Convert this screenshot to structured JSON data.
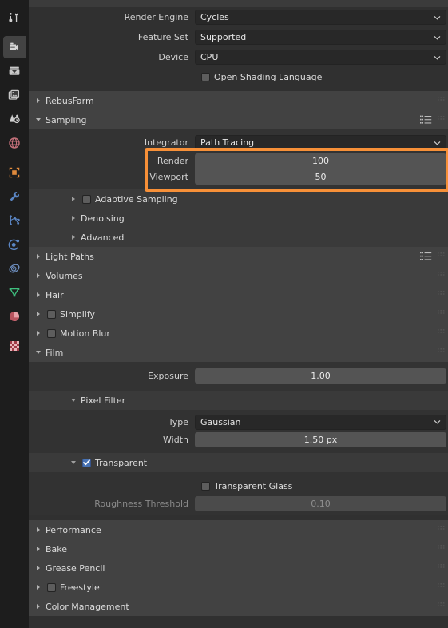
{
  "app": {
    "name": "Blender",
    "editor": "Properties Editor",
    "active_tab": "render-properties",
    "accent_orange": "#f79038",
    "accent_blue": "#4772b3",
    "bg": "#303030",
    "panel_header_bg": "#424242",
    "field_bg": "#545454",
    "dropdown_bg": "#282828"
  },
  "tabs": [
    {
      "name": "tool",
      "icon": "tool-icon",
      "active": false
    },
    {
      "name": "render-properties",
      "icon": "camera-back-icon",
      "active": true
    },
    {
      "name": "output-properties",
      "icon": "printer-icon",
      "active": false
    },
    {
      "name": "view-layer-properties",
      "icon": "images-icon",
      "active": false
    },
    {
      "name": "scene-properties",
      "icon": "cone-droplet-icon",
      "active": false
    },
    {
      "name": "world-properties",
      "icon": "globe-icon",
      "active": false
    },
    {
      "name": "object-properties",
      "icon": "orange-square-icon",
      "active": false
    },
    {
      "name": "modifier-properties",
      "icon": "wrench-icon",
      "active": false
    },
    {
      "name": "particle-properties",
      "icon": "particles-icon",
      "active": false
    },
    {
      "name": "physics-properties",
      "icon": "physics-orbit-icon",
      "active": false
    },
    {
      "name": "constraint-properties",
      "icon": "constraint-icon",
      "active": false
    },
    {
      "name": "object-data-properties",
      "icon": "green-triangle-mesh-icon",
      "active": false
    },
    {
      "name": "material-properties",
      "icon": "material-sphere-icon",
      "active": false
    },
    {
      "name": "texture-properties",
      "icon": "checker-texture-icon",
      "active": false
    }
  ],
  "render": {
    "engine": {
      "label": "Render Engine",
      "value": "Cycles"
    },
    "feature_set": {
      "label": "Feature Set",
      "value": "Supported"
    },
    "device": {
      "label": "Device",
      "value": "CPU"
    },
    "osl": {
      "label": "Open Shading Language",
      "checked": false
    }
  },
  "panels": {
    "rebusfarm": {
      "label": "RebusFarm",
      "open": false,
      "checkbox": null
    },
    "sampling": {
      "label": "Sampling",
      "open": true,
      "checkbox": null,
      "has_presets": true
    },
    "light_paths": {
      "label": "Light Paths",
      "open": false,
      "checkbox": null,
      "has_presets": true
    },
    "volumes": {
      "label": "Volumes",
      "open": false,
      "checkbox": null
    },
    "hair": {
      "label": "Hair",
      "open": false,
      "checkbox": null
    },
    "simplify": {
      "label": "Simplify",
      "open": false,
      "checkbox": false
    },
    "motion_blur": {
      "label": "Motion Blur",
      "open": false,
      "checkbox": false
    },
    "film": {
      "label": "Film",
      "open": true,
      "checkbox": null
    },
    "performance": {
      "label": "Performance",
      "open": false,
      "checkbox": null
    },
    "bake": {
      "label": "Bake",
      "open": false,
      "checkbox": null
    },
    "grease_pencil": {
      "label": "Grease Pencil",
      "open": false,
      "checkbox": null
    },
    "freestyle": {
      "label": "Freestyle",
      "open": false,
      "checkbox": false
    },
    "color_management": {
      "label": "Color Management",
      "open": false,
      "checkbox": null
    }
  },
  "sampling": {
    "integrator": {
      "label": "Integrator",
      "value": "Path Tracing"
    },
    "render": {
      "label": "Render",
      "value": "100"
    },
    "viewport": {
      "label": "Viewport",
      "value": "50"
    },
    "highlighted": true,
    "subpanels": [
      {
        "label": "Adaptive Sampling",
        "open": false,
        "checkbox": false
      },
      {
        "label": "Denoising",
        "open": false,
        "checkbox": null
      },
      {
        "label": "Advanced",
        "open": false,
        "checkbox": null
      }
    ]
  },
  "film": {
    "exposure": {
      "label": "Exposure",
      "value": "1.00"
    },
    "pixel_filter": {
      "label": "Pixel Filter",
      "open": true,
      "type": {
        "label": "Type",
        "value": "Gaussian"
      },
      "width": {
        "label": "Width",
        "value": "1.50 px"
      }
    },
    "transparent": {
      "label": "Transparent",
      "open": true,
      "checked": true,
      "transparent_glass": {
        "label": "Transparent Glass",
        "checked": false
      },
      "roughness_threshold": {
        "label": "Roughness Threshold",
        "value": "0.10",
        "enabled": false
      }
    }
  }
}
